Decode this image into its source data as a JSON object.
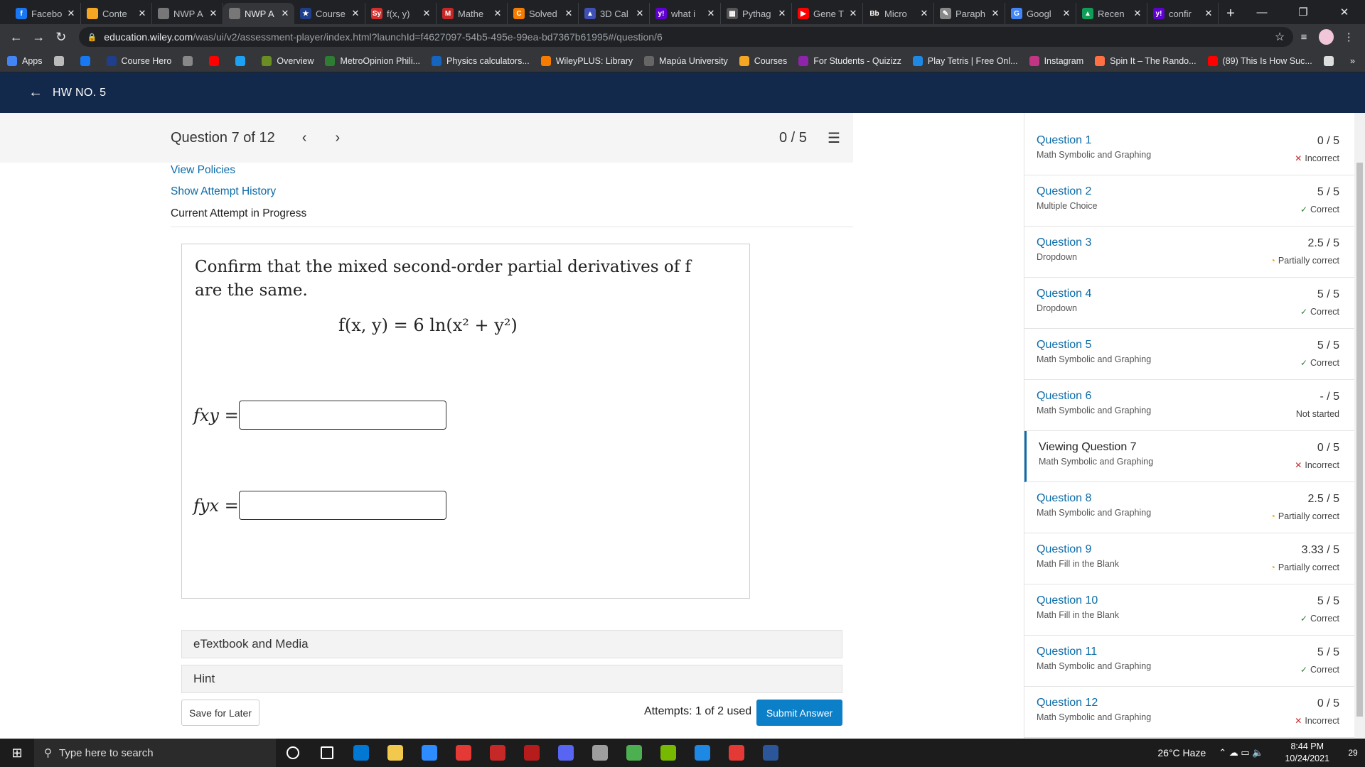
{
  "browser": {
    "tabs": [
      {
        "label": "Facebo",
        "color": "#1877f2",
        "glyph": "f"
      },
      {
        "label": "Conte",
        "color": "#f5a623",
        "glyph": ""
      },
      {
        "label": "NWP A",
        "color": "#777777",
        "glyph": ""
      },
      {
        "label": "NWP A",
        "color": "#777777",
        "glyph": "",
        "active": true
      },
      {
        "label": "Course",
        "color": "#1f3f8c",
        "glyph": "★"
      },
      {
        "label": "f(x, y)",
        "color": "#d32f2f",
        "glyph": "Sy"
      },
      {
        "label": "Mathe",
        "color": "#c62828",
        "glyph": "M"
      },
      {
        "label": "Solved",
        "color": "#f57c00",
        "glyph": "C"
      },
      {
        "label": "3D Cal",
        "color": "#3f51b5",
        "glyph": "▲"
      },
      {
        "label": "what i",
        "color": "#6001d2",
        "glyph": "y!"
      },
      {
        "label": "Pythag",
        "color": "#555555",
        "glyph": "▦"
      },
      {
        "label": "Gene T",
        "color": "#ff0000",
        "glyph": "▶"
      },
      {
        "label": "Micro",
        "color": "#222222",
        "glyph": "Bb"
      },
      {
        "label": "Paraph",
        "color": "#888888",
        "glyph": "✎"
      },
      {
        "label": "Googl",
        "color": "#4285f4",
        "glyph": "G"
      },
      {
        "label": "Recen",
        "color": "#0f9d58",
        "glyph": "▲"
      },
      {
        "label": "confir",
        "color": "#6001d2",
        "glyph": "y!"
      }
    ],
    "new_tab": "+",
    "url_host": "education.wiley.com",
    "url_path": "/was/ui/v2/assessment-player/index.html?launchId=f4627097-54b5-495e-99ea-bd7367b61995#/question/6",
    "bookmarks": [
      {
        "label": "Apps",
        "color": "#4285f4"
      },
      {
        "label": "",
        "color": "#bbbbbb"
      },
      {
        "label": "",
        "color": "#1877f2"
      },
      {
        "label": "Course Hero",
        "color": "#1f3f8c"
      },
      {
        "label": "",
        "color": "#888888"
      },
      {
        "label": "",
        "color": "#ff0000"
      },
      {
        "label": "",
        "color": "#1da1f2"
      },
      {
        "label": "Overview",
        "color": "#6b8e23"
      },
      {
        "label": "MetroOpinion Phili...",
        "color": "#2e7d32"
      },
      {
        "label": "Physics calculators...",
        "color": "#1565c0"
      },
      {
        "label": "WileyPLUS: Library",
        "color": "#f57c00"
      },
      {
        "label": "Mapúa University",
        "color": "#666666"
      },
      {
        "label": "Courses",
        "color": "#f5a623"
      },
      {
        "label": "For Students - Quizizz",
        "color": "#8e24aa"
      },
      {
        "label": "Play Tetris | Free Onl...",
        "color": "#1e88e5"
      },
      {
        "label": "Instagram",
        "color": "#c13584"
      },
      {
        "label": "Spin It – The Rando...",
        "color": "#ff7043"
      },
      {
        "label": "(89) This Is How Suc...",
        "color": "#ff0000"
      },
      {
        "label": "",
        "color": "#dddddd"
      }
    ],
    "more": "»"
  },
  "app": {
    "header_title": "HW NO. 5"
  },
  "question": {
    "counter": "Question 7 of 12",
    "score": "0 / 5",
    "view_policies": "View Policies",
    "show_attempt_history": "Show Attempt History",
    "current_attempt": "Current Attempt in Progress",
    "prompt_line1": "Confirm that the mixed second-order partial derivatives of f",
    "prompt_line2": "are the same.",
    "formula": "f(x, y) = 6 ln(x² + y²)",
    "fxy_label": "fxy =",
    "fyx_label": "fyx =",
    "fxy_value": "",
    "fyx_value": "",
    "etextbook": "eTextbook and Media",
    "hint": "Hint",
    "save_for_later": "Save for Later",
    "attempts": "Attempts: 1 of 2 used",
    "submit": "Submit Answer"
  },
  "sidebar": {
    "items": [
      {
        "title": "Question 1",
        "type": "Math Symbolic and Graphing",
        "points": "0 / 5",
        "status": "Incorrect",
        "icon": "✕"
      },
      {
        "title": "Question 2",
        "type": "Multiple Choice",
        "points": "5 / 5",
        "status": "Correct",
        "icon": "✓"
      },
      {
        "title": "Question 3",
        "type": "Dropdown",
        "points": "2.5 / 5",
        "status": "Partially correct",
        "icon": "◔"
      },
      {
        "title": "Question 4",
        "type": "Dropdown",
        "points": "5 / 5",
        "status": "Correct",
        "icon": "✓"
      },
      {
        "title": "Question 5",
        "type": "Math Symbolic and Graphing",
        "points": "5 / 5",
        "status": "Correct",
        "icon": "✓"
      },
      {
        "title": "Question 6",
        "type": "Math Symbolic and Graphing",
        "points": "- / 5",
        "status": "Not started",
        "icon": ""
      },
      {
        "title": "Viewing Question 7",
        "type": "Math Symbolic and Graphing",
        "points": "0 / 5",
        "status": "Incorrect",
        "icon": "✕",
        "viewing": true
      },
      {
        "title": "Question 8",
        "type": "Math Symbolic and Graphing",
        "points": "2.5 / 5",
        "status": "Partially correct",
        "icon": "◔"
      },
      {
        "title": "Question 9",
        "type": "Math Fill in the Blank",
        "points": "3.33 / 5",
        "status": "Partially correct",
        "icon": "◔"
      },
      {
        "title": "Question 10",
        "type": "Math Fill in the Blank",
        "points": "5 / 5",
        "status": "Correct",
        "icon": "✓"
      },
      {
        "title": "Question 11",
        "type": "Math Symbolic and Graphing",
        "points": "5 / 5",
        "status": "Correct",
        "icon": "✓"
      },
      {
        "title": "Question 12",
        "type": "Math Symbolic and Graphing",
        "points": "0 / 5",
        "status": "Incorrect",
        "icon": "✕"
      }
    ]
  },
  "taskbar": {
    "search_placeholder": "Type here to search",
    "weather": "26°C  Haze",
    "time": "8:44 PM",
    "date": "10/24/2021",
    "notifications": "29",
    "apps": [
      "#ffffff",
      "#ffffff",
      "#0078d4",
      "#f2c94c",
      "#2d8cff",
      "#e53935",
      "#c62828",
      "#b71c1c",
      "#5865f2",
      "#9e9e9e",
      "#4caf50",
      "#76b900",
      "#1e88e5",
      "#e53935",
      "#2b579a"
    ]
  },
  "colors": {
    "header_bg": "#13294b",
    "link": "#0b6ba8",
    "submit": "#0b7fc7"
  }
}
